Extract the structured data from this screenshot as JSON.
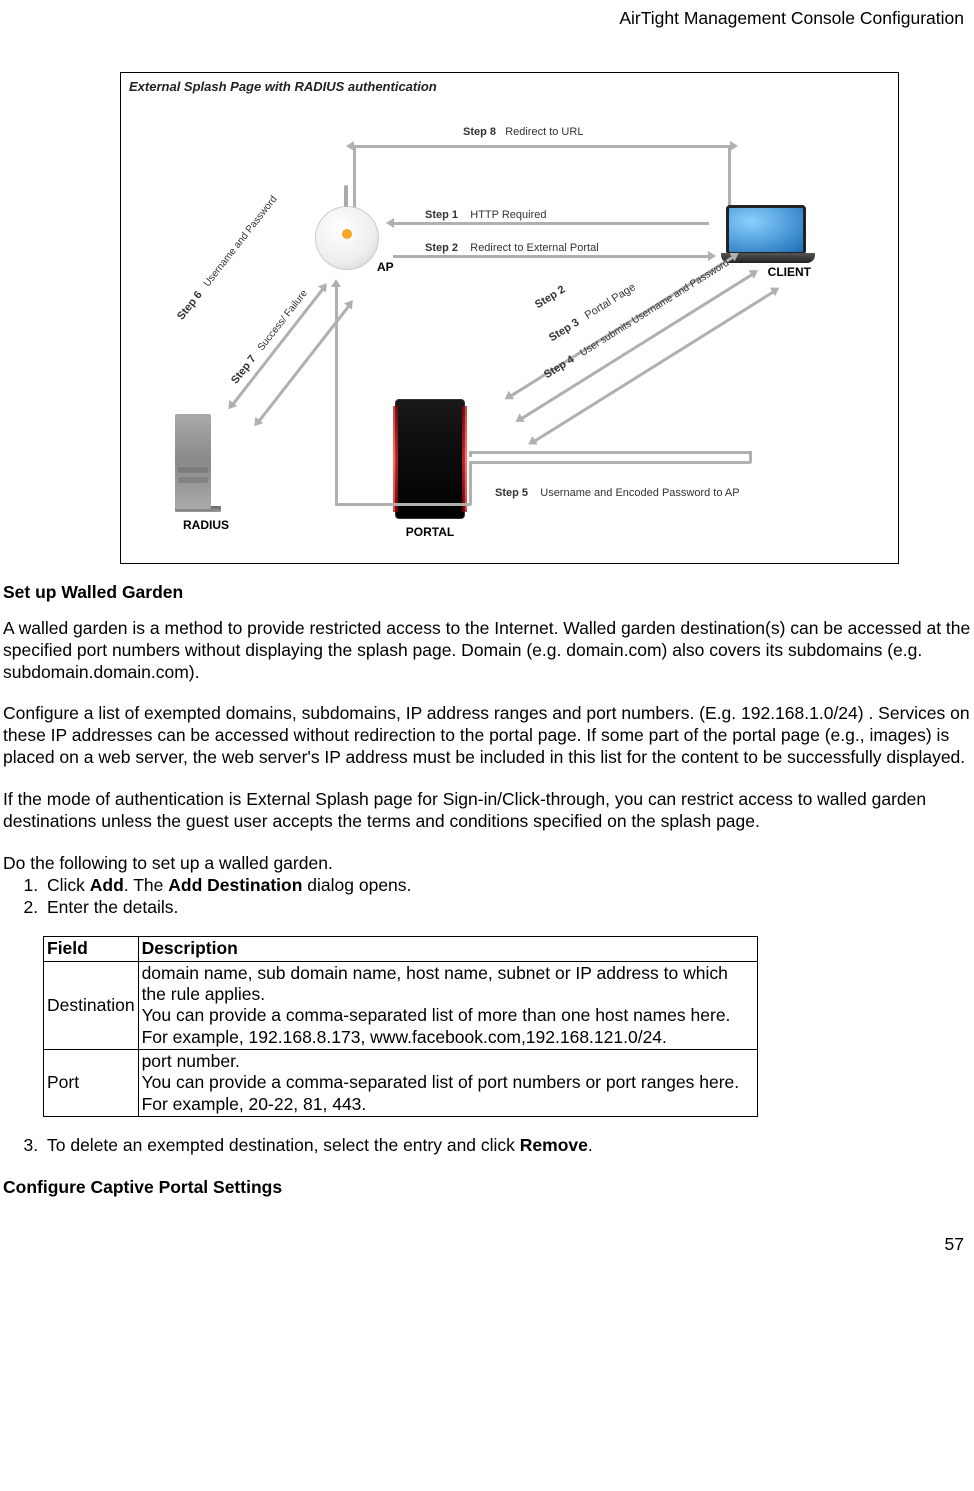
{
  "header": "AirTight Management Console Configuration",
  "page_number": "57",
  "diagram": {
    "title": "External Splash Page with RADIUS authentication",
    "devices": {
      "ap": "AP",
      "client": "CLIENT",
      "radius": "RADIUS",
      "portal": "PORTAL"
    },
    "steps": {
      "s1": {
        "tag": "Step 1",
        "text": "HTTP Required"
      },
      "s2a": {
        "tag": "Step 2",
        "text": "Redirect to External Portal"
      },
      "s2b": {
        "tag": "Step 2",
        "text": ""
      },
      "s3": {
        "tag": "Step 3",
        "text": "Portal Page"
      },
      "s4": {
        "tag": "Step 4",
        "text": "User submits Username and Password"
      },
      "s5": {
        "tag": "Step 5",
        "text": "Username and Encoded  Password to AP"
      },
      "s6": {
        "tag": "Step 6",
        "text": "Username and Password"
      },
      "s7": {
        "tag": "Step 7",
        "text": "Success/ Failure"
      },
      "s8": {
        "tag": "Step 8",
        "text": "Redirect to URL"
      }
    }
  },
  "section1_heading": "Set up Walled Garden",
  "para1": "A walled garden is a method to provide restricted access to the Internet. Walled garden destination(s) can be accessed at the specified port numbers without displaying the splash page. Domain (e.g. domain.com) also covers its subdomains (e.g. subdomain.domain.com).",
  "para2": "Configure a list of exempted domains, subdomains, IP address ranges and port numbers. (E.g. 192.168.1.0/24) . Services on these IP addresses can be accessed without redirection to the portal page.  If some part of the portal page (e.g., images) is placed on a web server, the web server's IP address must be included in this list for the content to be successfully displayed.",
  "para3": "If the mode of authentication is External Splash page for Sign-in/Click-through, you can restrict access to walled garden destinations unless the guest user accepts the terms and conditions specified on the splash page.",
  "para4": "Do the following to set up a walled garden.",
  "list1": {
    "i1_pre": "Click ",
    "i1_b1": "Add",
    "i1_mid": ". The ",
    "i1_b2": "Add Destination",
    "i1_post": " dialog opens.",
    "i2": "Enter the details."
  },
  "table": {
    "h1": "Field",
    "h2": "Description",
    "r1": {
      "field": "Destination",
      "desc": "domain name, sub domain name, host name, subnet or IP address to which the rule applies.\nYou can provide a comma-separated list of more than one host names here. For example, 192.168.8.173, www.facebook.com,192.168.121.0/24."
    },
    "r2": {
      "field": "Port",
      "desc": "port number.\nYou can provide a comma-separated list of port numbers or port ranges here. For example, 20-22, 81, 443."
    }
  },
  "list2": {
    "i3_pre": "To delete an exempted destination, select the entry and click ",
    "i3_b": "Remove",
    "i3_post": "."
  },
  "section2_heading": "Configure Captive Portal Settings"
}
